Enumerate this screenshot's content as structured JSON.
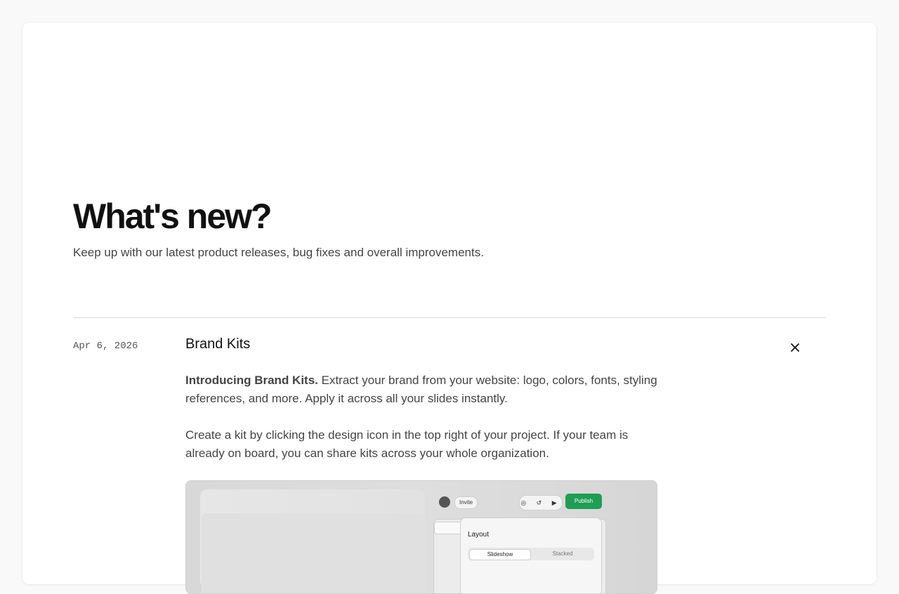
{
  "hero": {
    "title": "What's new?",
    "subtitle": "Keep up with our latest product releases, bug fixes and overall improvements."
  },
  "entry": {
    "date": "Apr 6, 2026",
    "title": "Brand Kits",
    "close_icon": "close-icon",
    "intro_bold": "Introducing Brand Kits.",
    "intro_rest": " Extract your brand from your website: logo, colors, fonts, styling references, and more. Apply it across all your slides instantly.",
    "paragraph2": "Create a kit by clicking the design icon in the top right of your project. If your team is already on board, you can share kits across your whole organization."
  },
  "preview": {
    "invite_label": "Invite",
    "icons": "◎ ↺ ▶",
    "publish_label": "Publish",
    "panel_title": "Layout",
    "segment_a": "Slideshow",
    "segment_b": "Stacked"
  },
  "colors": {
    "publish_green": "#1e9e54",
    "page_bg": "#f9f9f9",
    "card_bg": "#ffffff"
  }
}
